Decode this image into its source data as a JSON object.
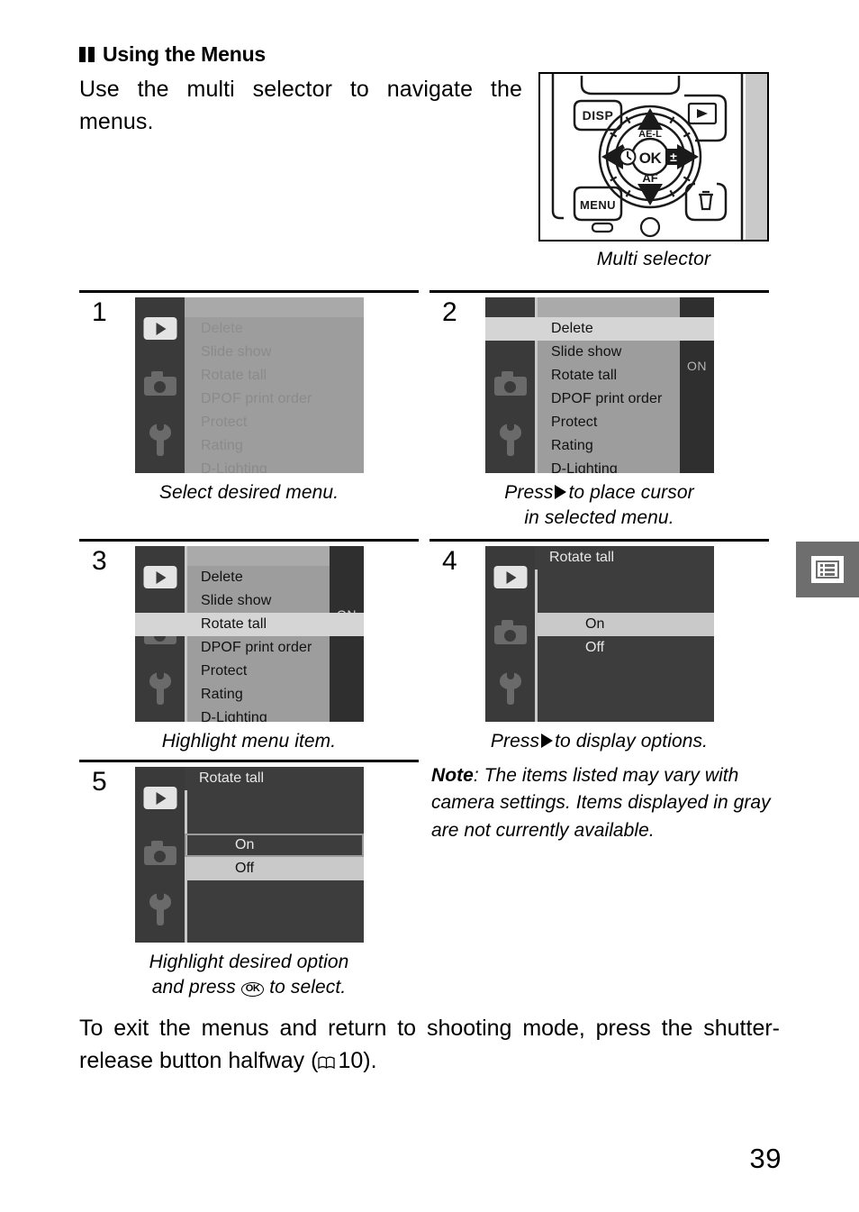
{
  "header": {
    "title": "Using the Menus",
    "body": "Use the multi selector to navigate the menus."
  },
  "figure": {
    "caption": "Multi selector",
    "buttons": {
      "disp": "DISP",
      "playback": "playback-icon",
      "menu": "MENU",
      "delete": "trash-icon",
      "ok": "OK",
      "ae_af_lock": "AE-L\nAF-L",
      "ae_l": "AE-L",
      "af_l": "AF-L",
      "af": "AF",
      "self_timer": "self-timer-icon",
      "exposure_comp": "exposure-compensation-icon"
    }
  },
  "steps": [
    {
      "number": "1",
      "screen_type": "menu",
      "state": "dimmed",
      "items": [
        "Delete",
        "Slide show",
        "Rotate tall",
        "DPOF print order",
        "Protect",
        "Rating",
        "D-Lighting"
      ],
      "highlighted": null,
      "value": null,
      "caption": "Select desired menu."
    },
    {
      "number": "2",
      "screen_type": "menu",
      "state": "active",
      "items": [
        "Delete",
        "Slide show",
        "Rotate tall",
        "DPOF print order",
        "Protect",
        "Rating",
        "D-Lighting"
      ],
      "highlighted": "Delete",
      "value": "ON",
      "caption_line1": "Press",
      "caption_line1_end": "to place cursor",
      "caption_line2": "in selected menu."
    },
    {
      "number": "3",
      "screen_type": "menu",
      "state": "active",
      "items": [
        "Delete",
        "Slide show",
        "Rotate tall",
        "DPOF print order",
        "Protect",
        "Rating",
        "D-Lighting"
      ],
      "highlighted": "Rotate tall",
      "value": "ON",
      "caption": "Highlight menu item."
    },
    {
      "number": "4",
      "screen_type": "options",
      "title": "Rotate tall",
      "options": [
        "On",
        "Off"
      ],
      "highlighted": "On",
      "boxed": null,
      "caption_line1": "Press",
      "caption_line1_end": "to display options."
    },
    {
      "number": "5",
      "screen_type": "options",
      "title": "Rotate tall",
      "options": [
        "On",
        "Off"
      ],
      "highlighted": "Off",
      "boxed": "On",
      "caption_line1": "Highlight desired option",
      "caption_line2_pre": "and press",
      "caption_line2_ok": "OK",
      "caption_line2_post": "to select."
    }
  ],
  "note": {
    "label": "Note",
    "separator": ": ",
    "text": "The items listed may vary with camera settings. Items displayed in gray are not currently available."
  },
  "closing": {
    "text_before": "To exit the menus and return to shooting mode, press the shutter-release button halfway (",
    "page_ref": "10",
    "text_after": ")."
  },
  "side_tab": {
    "icon": "menu-list-icon"
  },
  "page_number": "39",
  "colors": {
    "lcd_body": "#3a3a3a",
    "lcd_menu_bg": "#9d9d9d",
    "lcd_menu_dark": "#3d3d3d",
    "highlight": "#d5d5d5",
    "side_tab": "#6e6e6e"
  }
}
